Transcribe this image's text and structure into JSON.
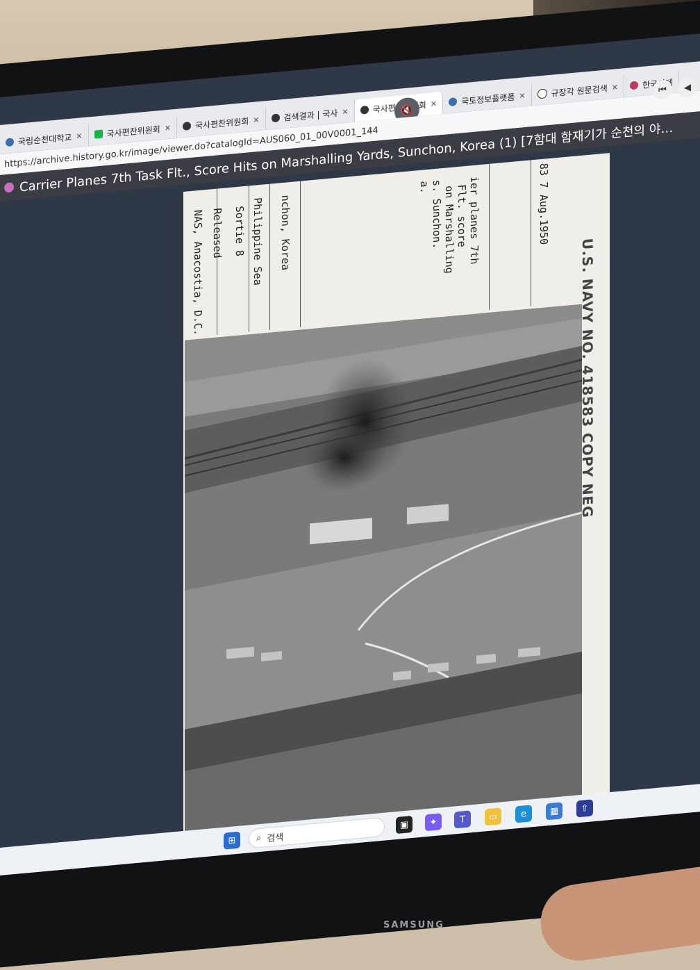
{
  "browser": {
    "tabs": [
      {
        "label": "국립순천대학교",
        "icon": "globe-icon"
      },
      {
        "label": "국사편찬위원회",
        "icon": "naver-icon"
      },
      {
        "label": "국사편찬위원회",
        "icon": "history-icon"
      },
      {
        "label": "검색결과 | 국사",
        "icon": "history-icon"
      },
      {
        "label": "국사편찬위원회",
        "icon": "history-icon",
        "active": true
      },
      {
        "label": "국토정보플랫폼",
        "icon": "globe-icon"
      },
      {
        "label": "규장각 원문검색",
        "icon": "globe-icon"
      },
      {
        "label": "한국사데",
        "icon": "history-icon"
      }
    ],
    "url": "https://archive.history.go.kr/image/viewer.do?catalogId=AUS060_01_00V0001_144",
    "page_title": "Carrier Planes 7th Task Flt., Score Hits on Marshalling Yards, Sunchon, Korea (1) [7함대 함재기가 순천의 야…"
  },
  "document": {
    "fields": [
      "NAS, Anacostia, D.C.",
      "Released",
      "Sortie 8",
      "Philippine Sea",
      "nchon, Korea",
      "ier planes 7th",
      "Flt. score",
      "on Marshalling",
      "s. Sunchon.",
      "a.",
      "83 7 Aug.1950"
    ],
    "stamp": "U.S. NAVY NO. 418583 COPY NEG"
  },
  "taskbar": {
    "search_placeholder": "검색"
  },
  "monitor_brand": "SAMSUNG"
}
